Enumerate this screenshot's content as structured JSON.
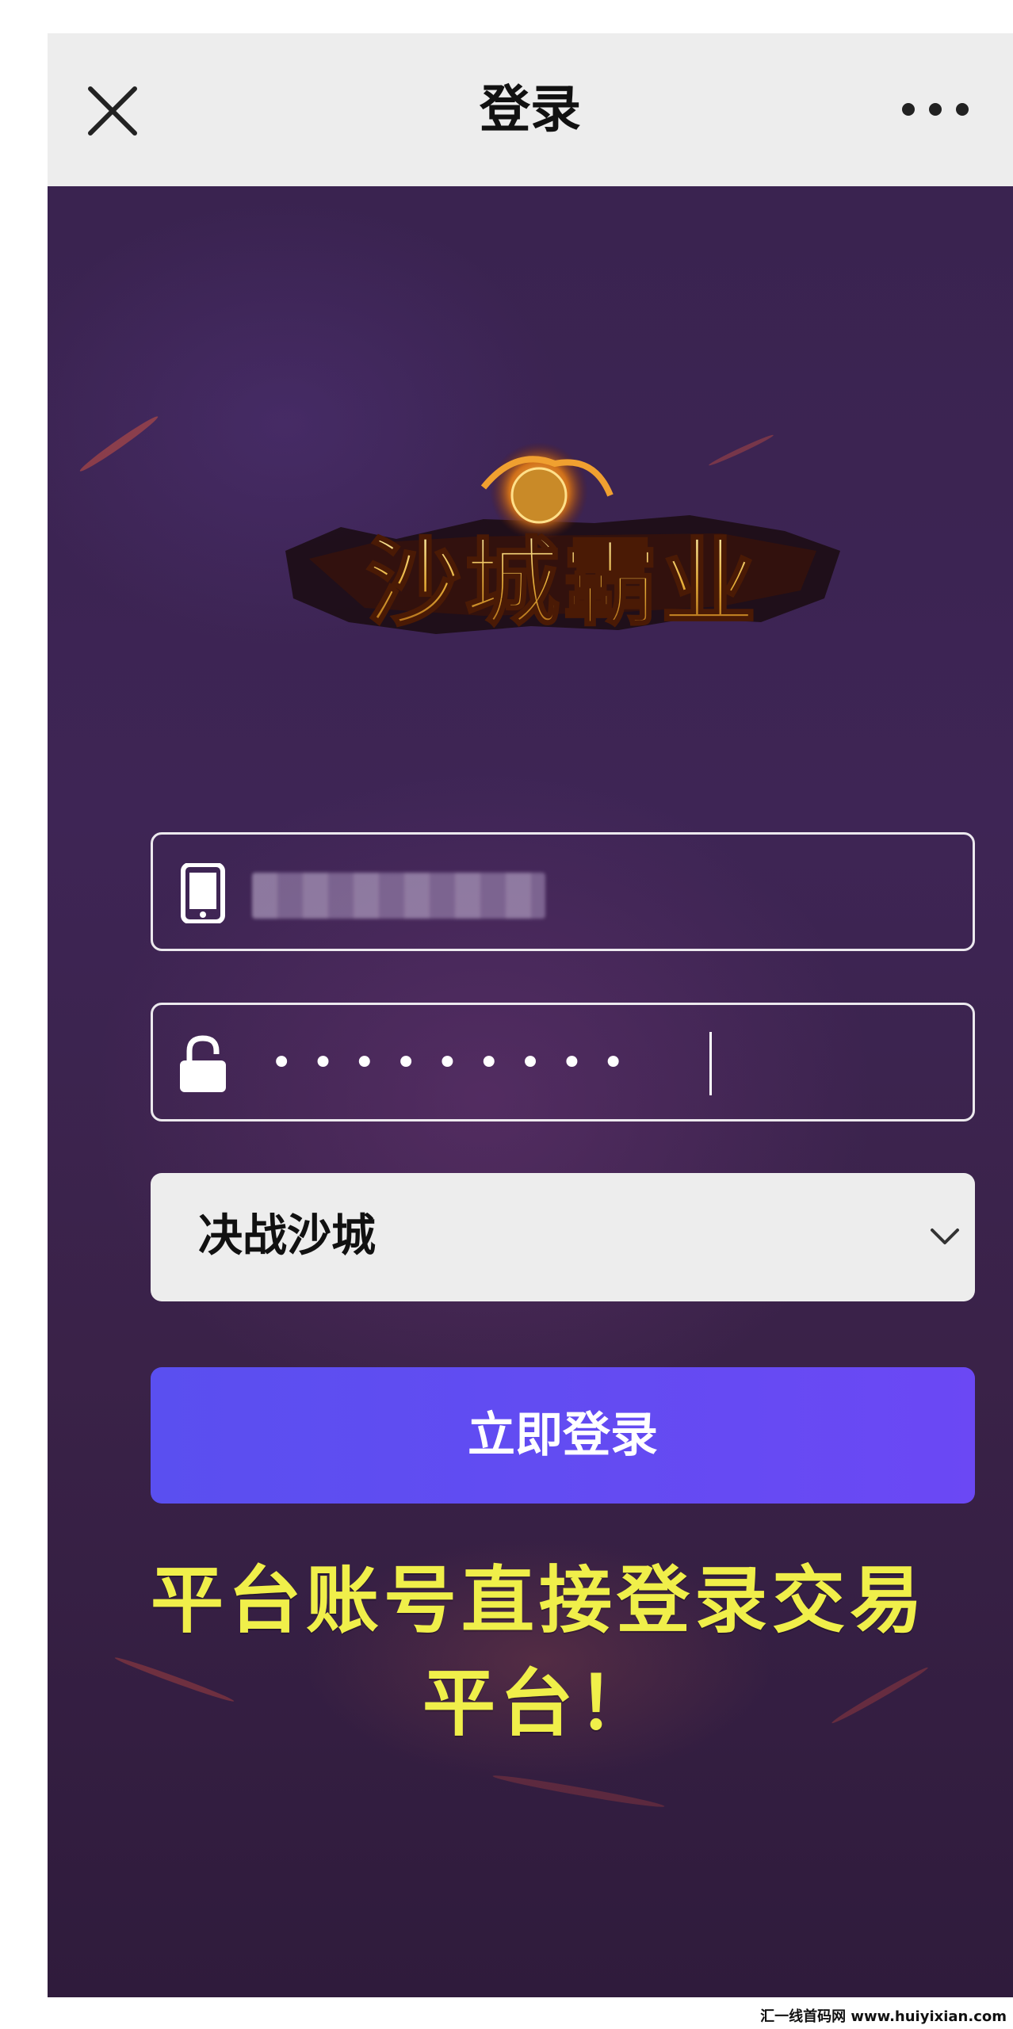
{
  "nav": {
    "title": "登录"
  },
  "game": {
    "logo_text": "沙城霸业"
  },
  "form": {
    "password_mask": "•••••••••",
    "server_selected": "决战沙城",
    "login_label": "立即登录"
  },
  "promo_text": "平台账号直接登录交易平台！",
  "watermark": "汇一线首码网 www.huiyixian.com",
  "colors": {
    "nav_bg": "#ededed",
    "button_start": "#5a4ff0",
    "button_end": "#6b48f4",
    "promo_text": "#f0ef4a",
    "bg_dark": "#3a2350"
  },
  "icons": [
    "close-icon",
    "more-icon",
    "phone-icon",
    "lock-icon",
    "chevron-down-icon"
  ]
}
